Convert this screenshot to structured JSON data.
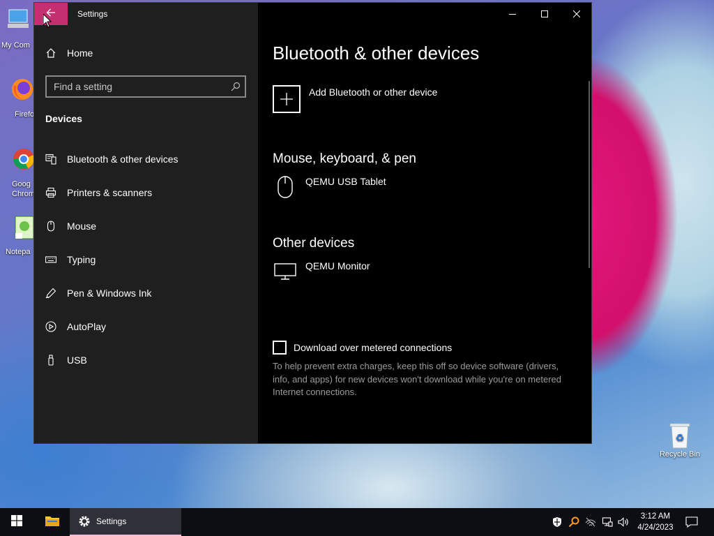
{
  "desktop": {
    "icons": [
      {
        "label": "My Com",
        "name": "my-computer"
      },
      {
        "label": "Firefo",
        "name": "firefox"
      },
      {
        "label": "Goog\nChrom",
        "name": "google-chrome"
      },
      {
        "label": "Notepa",
        "name": "notepad"
      },
      {
        "label": "Recycle Bin",
        "name": "recycle-bin"
      }
    ]
  },
  "window": {
    "title": "Settings",
    "back_icon": "arrow-left-icon",
    "controls": [
      "minimize",
      "maximize",
      "close"
    ]
  },
  "sidebar": {
    "home_label": "Home",
    "search_placeholder": "Find a setting",
    "group_title": "Devices",
    "items": [
      {
        "label": "Bluetooth & other devices",
        "icon": "bluetooth-devices-icon"
      },
      {
        "label": "Printers & scanners",
        "icon": "printer-icon"
      },
      {
        "label": "Mouse",
        "icon": "mouse-icon"
      },
      {
        "label": "Typing",
        "icon": "keyboard-icon"
      },
      {
        "label": "Pen & Windows Ink",
        "icon": "pen-icon"
      },
      {
        "label": "AutoPlay",
        "icon": "autoplay-icon"
      },
      {
        "label": "USB",
        "icon": "usb-icon"
      }
    ]
  },
  "main": {
    "title": "Bluetooth & other devices",
    "add_device_label": "Add Bluetooth or other device",
    "sections": [
      {
        "title": "Mouse, keyboard, & pen",
        "devices": [
          {
            "name": "QEMU USB Tablet",
            "icon": "mouse-icon"
          }
        ]
      },
      {
        "title": "Other devices",
        "devices": [
          {
            "name": "QEMU Monitor",
            "icon": "monitor-icon"
          }
        ]
      }
    ],
    "metered_checkbox_label": "Download over metered connections",
    "metered_checked": false,
    "help_text": "To help prevent extra charges, keep this off so device software (drivers, info, and apps) for new devices won't download while you're on metered Internet connections."
  },
  "taskbar": {
    "active_app_label": "Settings",
    "time": "3:12 AM",
    "date": "4/24/2023"
  },
  "colors": {
    "accent": "#c4306f",
    "window_bg": "#000000",
    "sidebar_bg": "#1f1f1f",
    "help_text": "#9b9b9b"
  }
}
